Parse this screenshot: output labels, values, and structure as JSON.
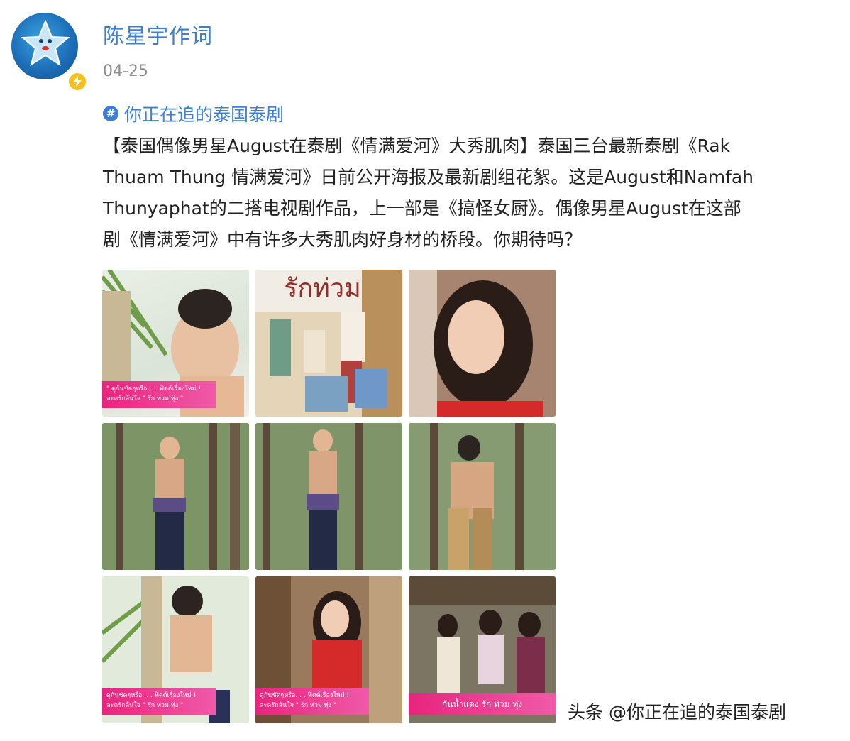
{
  "user": {
    "name": "陈星宇作词",
    "date": "04-25"
  },
  "topic": {
    "label": "你正在追的泰国泰剧"
  },
  "post": {
    "lines": [
      "【泰国偶像男星August在泰剧《情满爱河》大秀肌肉】泰国三台最新泰剧《Rak",
      "Thuam Thung 情满爱河》日前公开海报及最新剧组花絮。这是August和Namfah",
      "Thunyaphat的二搭电视剧作品，上一部是《搞怪女厨》。偶像男星August在这部",
      "剧《情满爱河》中有许多大秀肌肉好身材的桥段。你期待吗？"
    ]
  },
  "images": {
    "captions": {
      "p1": "\" ดูกันชัดๆหรือ. . . ฟิตต์เรื่องใหม่ !\n ละครักล้นใจ \" รัก ท่วม ทุ่ง \"",
      "p2": "ดูกันชัดๆหรือ. . . ฟิตต์เรื่องใหม่ !\nละครักล้นใจ \" รัก ท่วม ทุ่ง \"",
      "p3": "ดูกันชัดๆหรือ. . . ฟิตต์เรื่องใหม่ !\nละครักล้นใจ \" รัก ท่วม ทุ่ง \"",
      "p4": "กันน้ำแดง รัก ท่วม ทุ่ง"
    },
    "sign_text": "รักท่วม"
  },
  "watermark": {
    "text": "头条 @你正在追的泰国泰剧"
  }
}
